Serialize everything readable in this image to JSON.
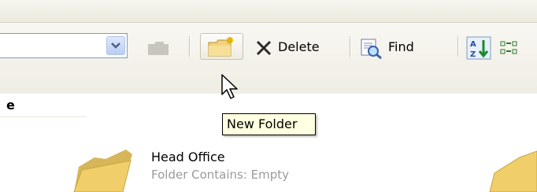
{
  "toolbar": {
    "delete_label": "Delete",
    "find_label": "Find"
  },
  "tooltip": {
    "text": "New Folder"
  },
  "column": {
    "header_text": "e"
  },
  "item": {
    "title": "Head Office",
    "subtitle": "Folder Contains: Empty"
  },
  "icons": [
    "dropdown-arrow-icon",
    "up-folder-icon",
    "new-folder-icon",
    "delete-x-icon",
    "find-icon",
    "sort-az-icon",
    "view-icon",
    "mouse-cursor-icon",
    "folder-icon"
  ],
  "colors": {
    "tooltip_bg": "#ffffe1",
    "subtitle_text": "#9a9a9a",
    "folder_yellow": "#f0cf6a"
  }
}
